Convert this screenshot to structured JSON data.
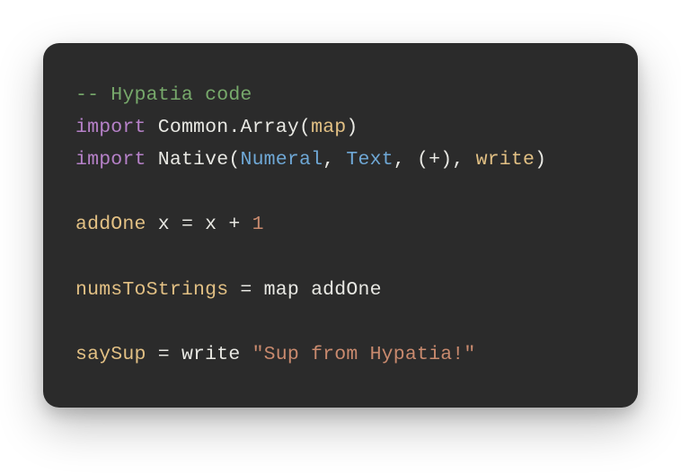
{
  "code": {
    "l1_comment": "-- Hypatia code",
    "l2_kw": "import",
    "l2_mod1": "Common",
    "l2_dot": ".",
    "l2_mod2": "Array",
    "l2_open": "(",
    "l2_fn": "map",
    "l2_close": ")",
    "l3_kw": "import",
    "l3_mod": "Native",
    "l3_open": "(",
    "l3_t1": "Numeral",
    "l3_c1": ", ",
    "l3_t2": "Text",
    "l3_c2": ", ",
    "l3_opp": "(",
    "l3_plus": "+",
    "l3_opc": ")",
    "l3_c3": ", ",
    "l3_fn": "write",
    "l3_close": ")",
    "l5_def": "addOne",
    "l5_arg": " x ",
    "l5_eq": "=",
    "l5_expr": " x ",
    "l5_plus": "+",
    "l5_sp": " ",
    "l5_num": "1",
    "l7_def": "numsToStrings",
    "l7_eq": " = ",
    "l7_fn1": "map",
    "l7_sp": " ",
    "l7_fn2": "addOne",
    "l9_def": "saySup",
    "l9_eq": " = ",
    "l9_fn": "write",
    "l9_sp": " ",
    "l9_str": "\"Sup from Hypatia!\""
  }
}
